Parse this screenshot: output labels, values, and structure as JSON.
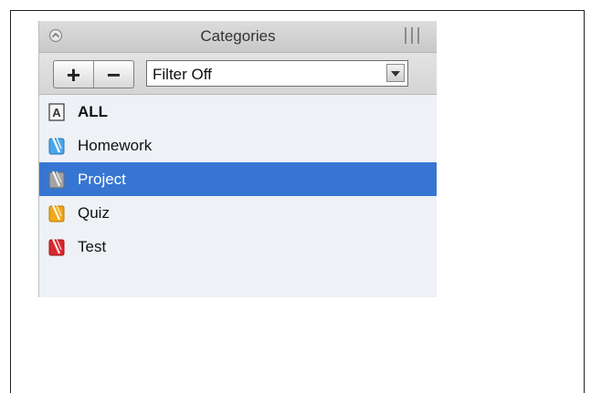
{
  "panel": {
    "title": "Categories",
    "add_label": "+",
    "remove_label": "−",
    "filter": {
      "value": "Filter Off"
    }
  },
  "categories": [
    {
      "label": "ALL",
      "icon": "all-letter-icon",
      "color": "#444444",
      "selected": false
    },
    {
      "label": "Homework",
      "icon": "clip-icon",
      "color": "#4aa6e8",
      "selected": false
    },
    {
      "label": "Project",
      "icon": "clip-icon",
      "color": "#9a9a9a",
      "selected": true
    },
    {
      "label": "Quiz",
      "icon": "clip-icon",
      "color": "#f0a81c",
      "selected": false
    },
    {
      "label": "Test",
      "icon": "clip-icon",
      "color": "#d9272f",
      "selected": false
    }
  ],
  "colors": {
    "selection": "#3676d2",
    "list_bg": "#eef1f6"
  }
}
